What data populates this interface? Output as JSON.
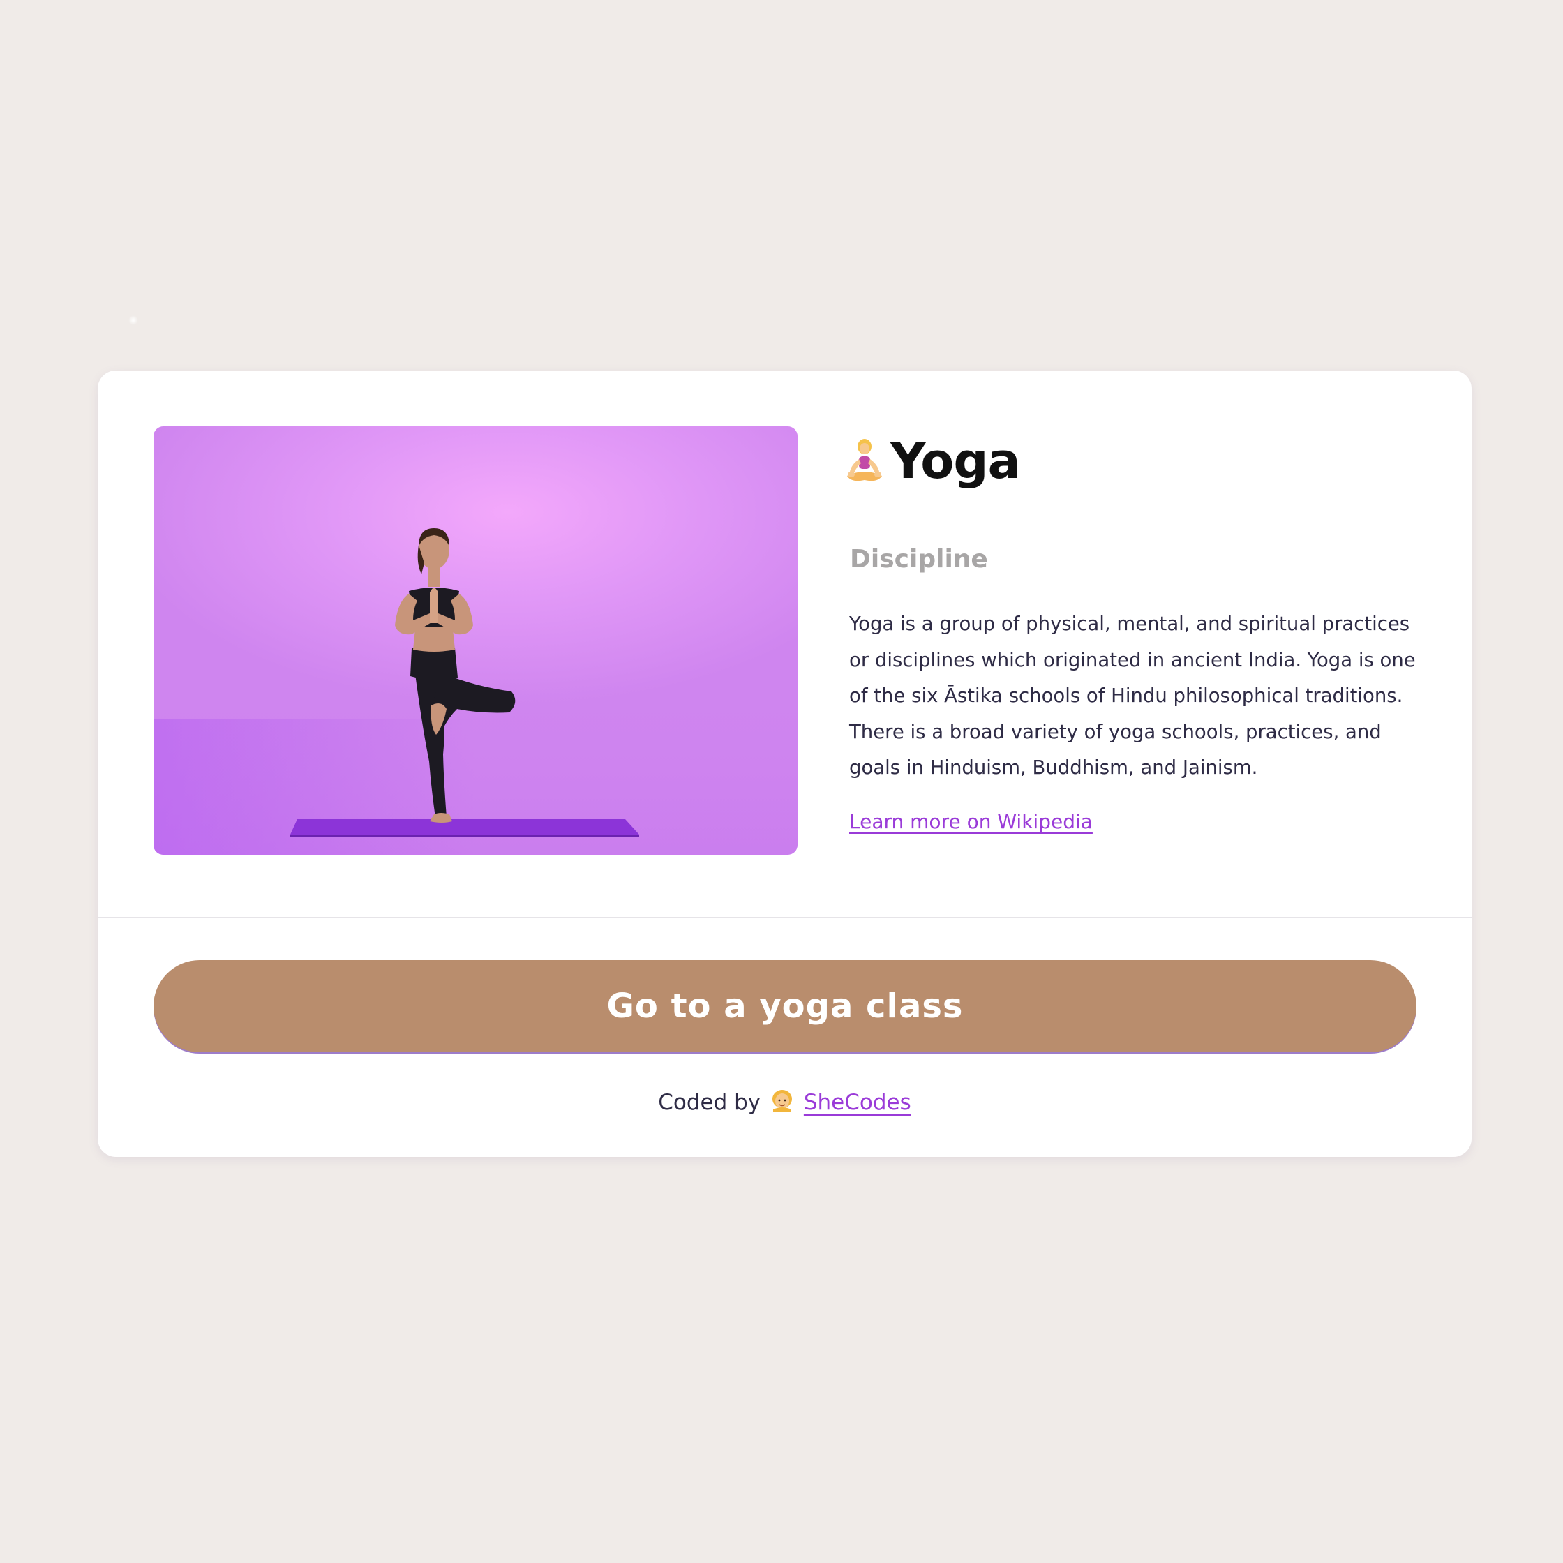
{
  "card": {
    "title": "Yoga",
    "title_icon": "lotus-position-emoji",
    "subtitle": "Discipline",
    "description": "Yoga is a group of physical, mental, and spiritual practices or disciplines which originated in ancient India. Yoga is one of the six Āstika schools of Hindu philosophical traditions. There is a broad variety of yoga schools, practices, and goals in Hinduism, Buddhism, and Jainism.",
    "link_label": "Learn more on Wikipedia",
    "photo_subject": "woman-in-tree-pose-photo"
  },
  "cta": {
    "label": "Go to a yoga class"
  },
  "footer": {
    "prefix": "Coded by",
    "icon": "woman-emoji",
    "link_label": "SheCodes"
  },
  "colors": {
    "page_background": "#f0ebe8",
    "card_background": "#ffffff",
    "button_background": "#b98d6d",
    "link": "#9a3bd8",
    "subtitle": "#a8a6a6",
    "body_text": "#2e2b45"
  }
}
